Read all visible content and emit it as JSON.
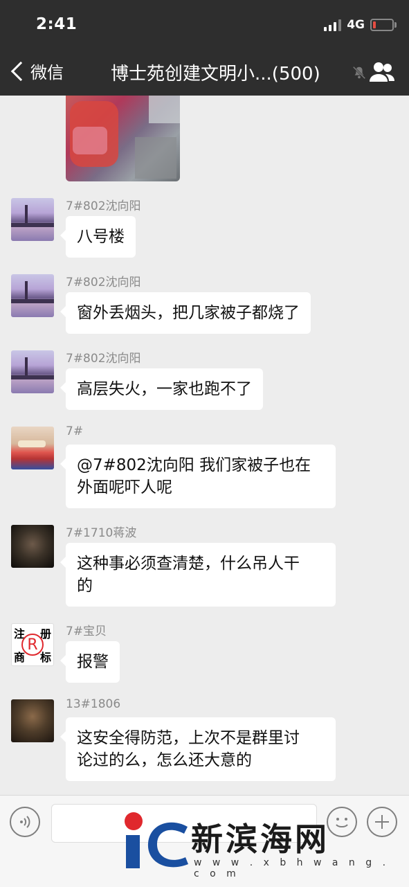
{
  "status_bar": {
    "time": "2:41",
    "network": "4G",
    "battery_level": 0.15,
    "battery_color": "#e54d42"
  },
  "header": {
    "back_label": "微信",
    "title": "博士苑创建文明小...(500)"
  },
  "messages": [
    {
      "sender": "7#802沈向阳",
      "text": "八号楼",
      "avatar": "city-skyline"
    },
    {
      "sender": "7#802沈向阳",
      "text": "窗外丢烟头，把几家被子都烧了",
      "avatar": "city-skyline"
    },
    {
      "sender": "7#802沈向阳",
      "text": "高层失火，一家也跑不了",
      "avatar": "city-skyline"
    },
    {
      "sender": "7#",
      "text_line1": "@7#802沈向阳 我们家被子也在",
      "text_line2": "外面呢吓人呢",
      "avatar": "bedroom"
    },
    {
      "sender": "7#1710蒋波",
      "text_line1": "这种事必须查清楚，什么吊人干",
      "text_line2": "的",
      "avatar": "man-portrait"
    },
    {
      "sender": "7#宝贝",
      "text": "报警",
      "avatar": "registered-trademark"
    },
    {
      "sender": "13#1806",
      "text_line1": "这安全得防范，上次不是群里讨",
      "text_line2": "论过的么，怎么还大意的",
      "avatar": "man-portrait-2"
    }
  ],
  "registered_avatar": {
    "tl": "注",
    "tr": "册",
    "bl": "商",
    "br": "标",
    "mark": "R"
  },
  "watermark": {
    "name": "新滨海网",
    "url": "w w w . x b h w a n g . c o m"
  },
  "colors": {
    "header_bg": "#2e2e2e",
    "chat_bg": "#ededed",
    "bubble_bg": "#ffffff"
  }
}
